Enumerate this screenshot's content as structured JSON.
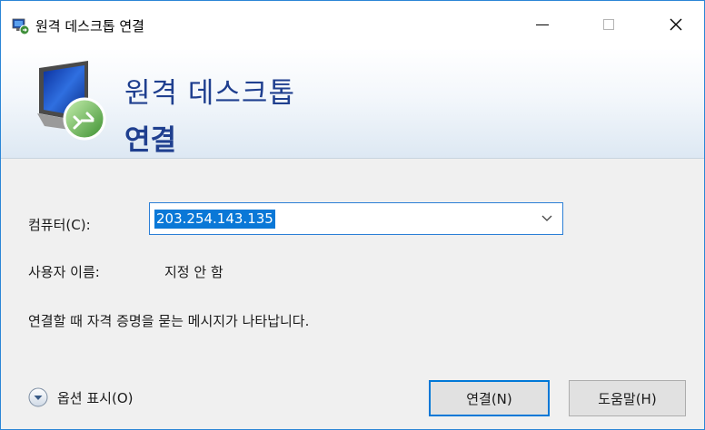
{
  "window": {
    "title": "원격 데스크톱 연결"
  },
  "banner": {
    "line1": "원격 데스크톱",
    "line2": "연결"
  },
  "form": {
    "computer_label": "컴퓨터(C):",
    "computer_value": "203.254.143.135",
    "user_label": "사용자 이름:",
    "user_value": "지정 안 함",
    "info_text": "연결할 때 자격 증명을 묻는 메시지가 나타납니다."
  },
  "footer": {
    "options_label": "옵션 표시(O)",
    "connect_label": "연결(N)",
    "help_label": "도움말(H)"
  },
  "colors": {
    "accent": "#0078d7",
    "banner_text": "#1f3f8f",
    "selection": "#0a78d7"
  },
  "icons": {
    "app": "remote-desktop-icon",
    "banner": "monitor-connection-icon",
    "minimize": "minimize-icon",
    "maximize": "maximize-icon",
    "close": "close-icon",
    "dropdown": "chevron-down-icon",
    "options": "expand-circle-icon"
  }
}
